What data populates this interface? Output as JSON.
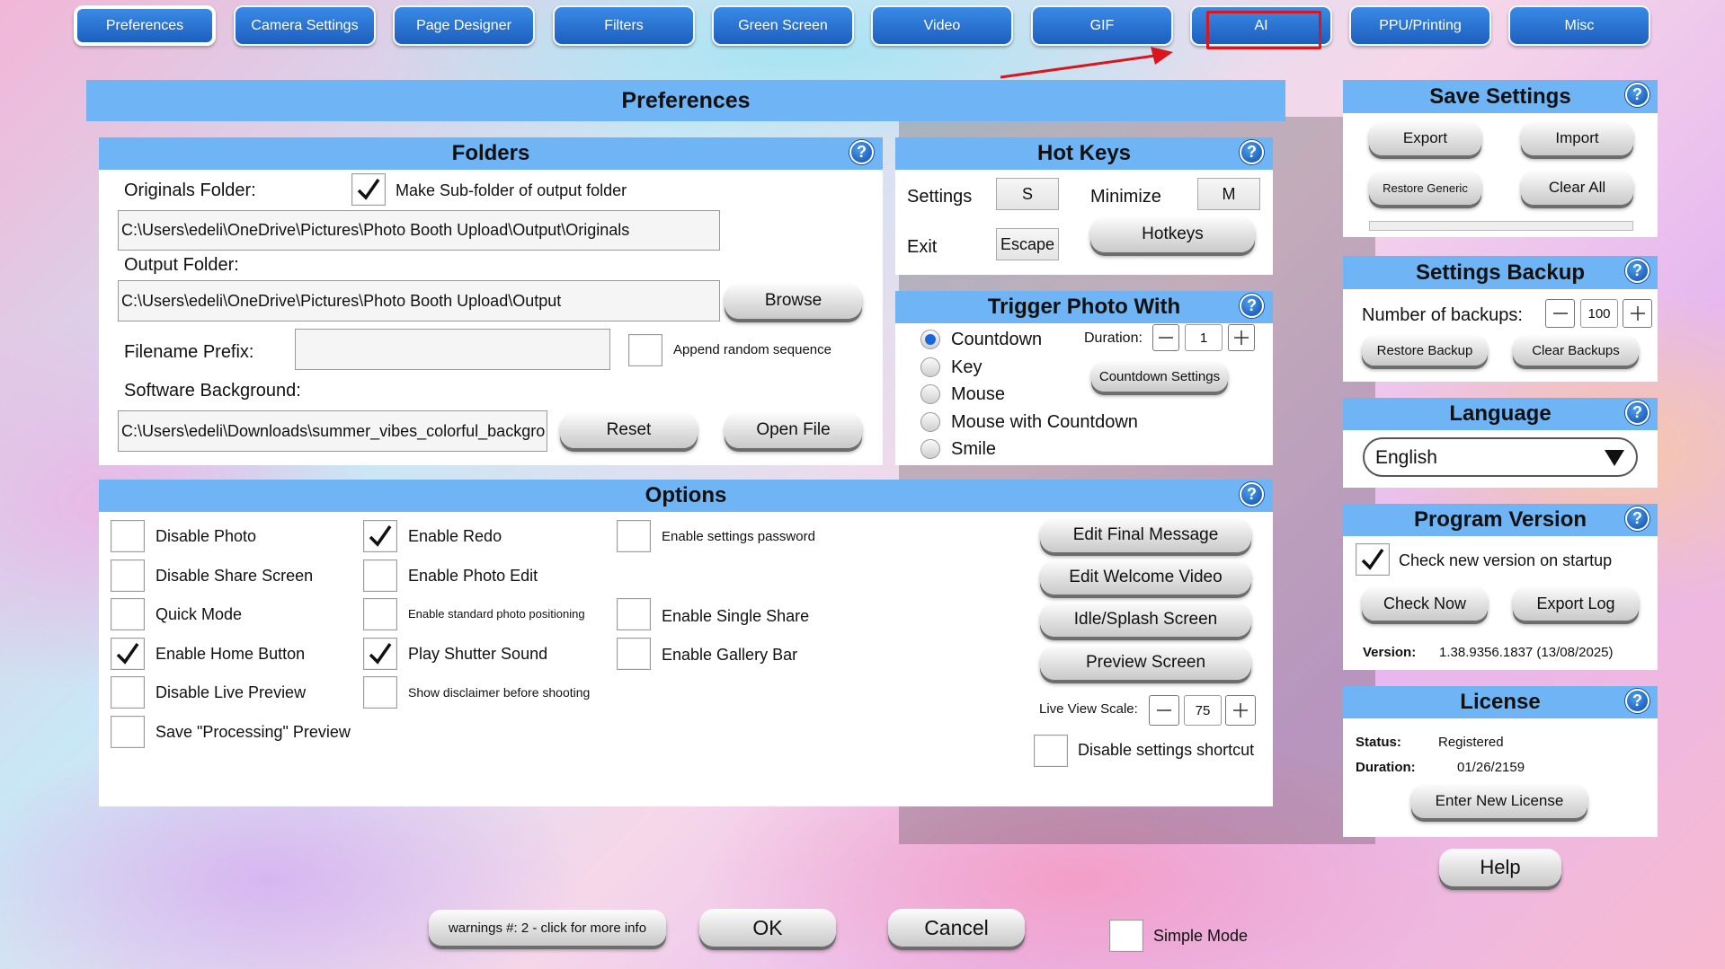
{
  "tabs": [
    "Preferences",
    "Camera Settings",
    "Page Designer",
    "Filters",
    "Green Screen",
    "Video",
    "GIF",
    "AI",
    "PPU/Printing",
    "Misc"
  ],
  "title": "Preferences",
  "folders": {
    "title": "Folders",
    "originals_label": "Originals Folder:",
    "subfolder_label": "Make Sub-folder of output folder",
    "subfolder_checked": true,
    "originals_path": "C:\\Users\\edeli\\OneDrive\\Pictures\\Photo Booth Upload\\Output\\Originals",
    "output_label": "Output Folder:",
    "output_path": "C:\\Users\\edeli\\OneDrive\\Pictures\\Photo Booth Upload\\Output",
    "browse": "Browse",
    "prefix_label": "Filename Prefix:",
    "prefix_value": "",
    "append_label": "Append random sequence",
    "background_label": "Software Background:",
    "background_path": "C:\\Users\\edeli\\Downloads\\summer_vibes_colorful_backgro",
    "reset": "Reset",
    "open_file": "Open File"
  },
  "hotkeys": {
    "title": "Hot Keys",
    "settings_label": "Settings",
    "settings_key": "S",
    "minimize_label": "Minimize",
    "minimize_key": "M",
    "exit_label": "Exit",
    "exit_key": "Escape",
    "hotkeys_button": "Hotkeys"
  },
  "trigger": {
    "title": "Trigger Photo With",
    "options": [
      "Countdown",
      "Key",
      "Mouse",
      "Mouse with Countdown",
      "Smile"
    ],
    "selected": "Countdown",
    "duration_label": "Duration:",
    "duration_value": "1",
    "countdown_settings": "Countdown Settings"
  },
  "options": {
    "title": "Options",
    "col1": [
      "Disable Photo",
      "Disable Share Screen",
      "Quick Mode",
      "Enable Home Button",
      "Disable Live Preview",
      "Save \"Processing\" Preview"
    ],
    "col2": [
      "Enable Redo",
      "Enable Photo Edit",
      "Enable standard photo positioning",
      "Play Shutter Sound",
      "Show disclaimer before shooting"
    ],
    "col3": [
      "Enable settings password",
      "Enable Single Share",
      "Enable Gallery Bar"
    ],
    "buttons": [
      "Edit Final Message",
      "Edit Welcome Video",
      "Idle/Splash Screen",
      "Preview Screen"
    ],
    "live_view_label": "Live View Scale:",
    "live_view_value": "75",
    "disable_shortcut": "Disable settings shortcut"
  },
  "save_settings": {
    "title": "Save Settings",
    "export": "Export",
    "import": "Import",
    "restore_generic": "Restore Generic",
    "clear_all": "Clear All"
  },
  "backup": {
    "title": "Settings Backup",
    "number_label": "Number of backups:",
    "number_value": "100",
    "restore": "Restore Backup",
    "clear": "Clear Backups"
  },
  "language": {
    "title": "Language",
    "selected": "English"
  },
  "version": {
    "title": "Program Version",
    "check_label": "Check new version on startup",
    "check_now": "Check Now",
    "export_log": "Export Log",
    "version_label": "Version:",
    "version_value": "1.38.9356.1837 (13/08/2025)"
  },
  "license": {
    "title": "License",
    "status_label": "Status:",
    "status_value": "Registered",
    "duration_label": "Duration:",
    "duration_value": "01/26/2159",
    "enter": "Enter New License"
  },
  "footer": {
    "help": "Help",
    "warnings": "warnings #: 2 - click for more info",
    "ok": "OK",
    "cancel": "Cancel",
    "simple_mode": "Simple Mode"
  },
  "colors": {
    "accent": "#6fb4f4",
    "tab": "#2a75d8",
    "highlight": "#d9161e"
  }
}
